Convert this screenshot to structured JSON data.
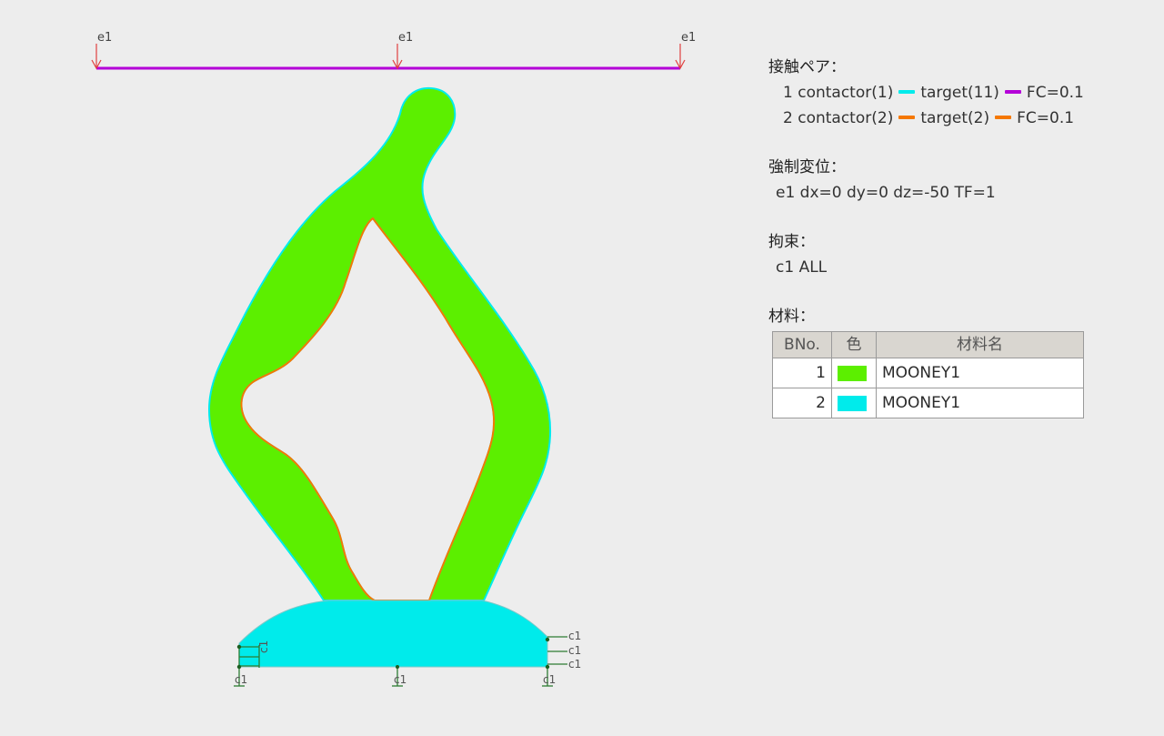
{
  "colors": {
    "background": "#ededed",
    "material1": "#5cef00",
    "material2": "#00ebeb",
    "contact_target1": "#b400d8",
    "contact_target2": "#f57800",
    "displacement": "#e04040",
    "constraint": "#2e7d32"
  },
  "model": {
    "displacement_labels": [
      "e1",
      "e1",
      "e1"
    ],
    "constraint_label": "c1"
  },
  "panel": {
    "contact": {
      "title": "接触ペア：",
      "pairs": [
        {
          "no": "1",
          "contactor": "contactor(1)",
          "contactor_color": "#00ebeb",
          "target": "target(11)",
          "target_color": "#b400d8",
          "fc": "FC=0.1"
        },
        {
          "no": "2",
          "contactor": "contactor(2)",
          "contactor_color": "#f57800",
          "target": "target(2)",
          "target_color": "#f57800",
          "fc": "FC=0.1"
        }
      ]
    },
    "displacement": {
      "title": "強制変位：",
      "text": "e1  dx=0 dy=0 dz=-50 TF=1"
    },
    "constraint": {
      "title": "拘束：",
      "text": "c1  ALL"
    },
    "material": {
      "title": "材料：",
      "headers": [
        "BNo.",
        "色",
        "材料名"
      ],
      "rows": [
        {
          "no": "1",
          "color": "#5cef00",
          "name": "MOONEY1"
        },
        {
          "no": "2",
          "color": "#00ebeb",
          "name": "MOONEY1"
        }
      ]
    }
  }
}
